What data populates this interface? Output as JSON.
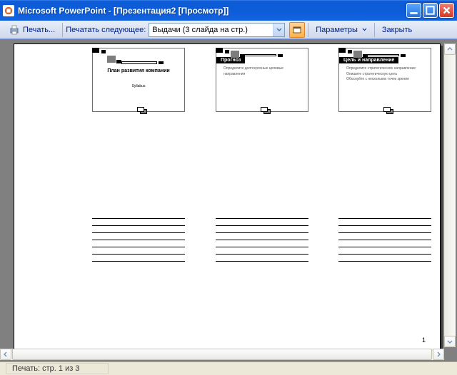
{
  "window": {
    "title": "Microsoft PowerPoint - [Презентация2 [Просмотр]]"
  },
  "toolbar": {
    "print": "Печать...",
    "print_what_label": "Печатать следующее:",
    "print_what_value": "Выдачи (3 слайда на стр.)",
    "options": "Параметры",
    "close": "Закрыть"
  },
  "slides": [
    {
      "title": "План развития компании",
      "subtitle": "Syllabus",
      "bullets": []
    },
    {
      "title": "Прогноз",
      "bullets": [
        "Определите долгосрочные целевые направления"
      ]
    },
    {
      "title": "Цель и направление",
      "bullets": [
        "Определите стратегическое направление",
        "Опишите стратегическую цель",
        "Обоснуйте с нескольких точек зрения"
      ]
    }
  ],
  "page": {
    "number": "1"
  },
  "status": {
    "text": "Печать: стр. 1 из 3"
  }
}
